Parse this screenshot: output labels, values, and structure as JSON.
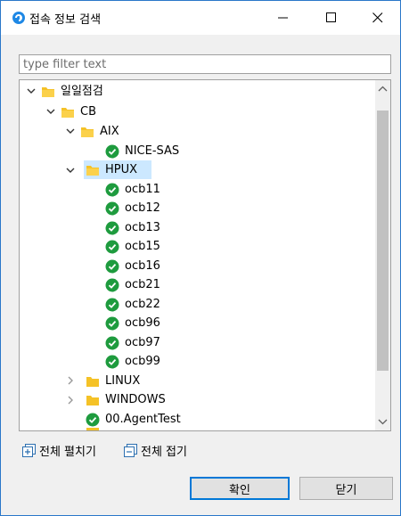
{
  "window": {
    "title": "접속 정보 검색"
  },
  "filter": {
    "placeholder": "type filter text",
    "value": ""
  },
  "tree": {
    "root": {
      "label": "일일점검",
      "state": "expanded"
    },
    "cb": {
      "label": "CB",
      "state": "expanded"
    },
    "aix": {
      "label": "AIX",
      "state": "expanded"
    },
    "nice_sas": {
      "label": "NICE-SAS"
    },
    "hpux": {
      "label": "HPUX",
      "state": "expanded",
      "selected": true
    },
    "hpux_children": [
      "ocb11",
      "ocb12",
      "ocb13",
      "ocb15",
      "ocb16",
      "ocb21",
      "ocb22",
      "ocb96",
      "ocb97",
      "ocb99"
    ],
    "linux": {
      "label": "LINUX",
      "state": "collapsed"
    },
    "windows": {
      "label": "WINDOWS",
      "state": "collapsed"
    },
    "agent_test": {
      "label": "00.AgentTest"
    }
  },
  "actions": {
    "expand_all": "전체 펼치기",
    "collapse_all": "전체 접기"
  },
  "buttons": {
    "ok": "확인",
    "close": "닫기"
  },
  "colors": {
    "folder": "#f5c227",
    "check": "#1e9b3e",
    "selection": "#cce8ff",
    "accent": "#0078d7"
  }
}
